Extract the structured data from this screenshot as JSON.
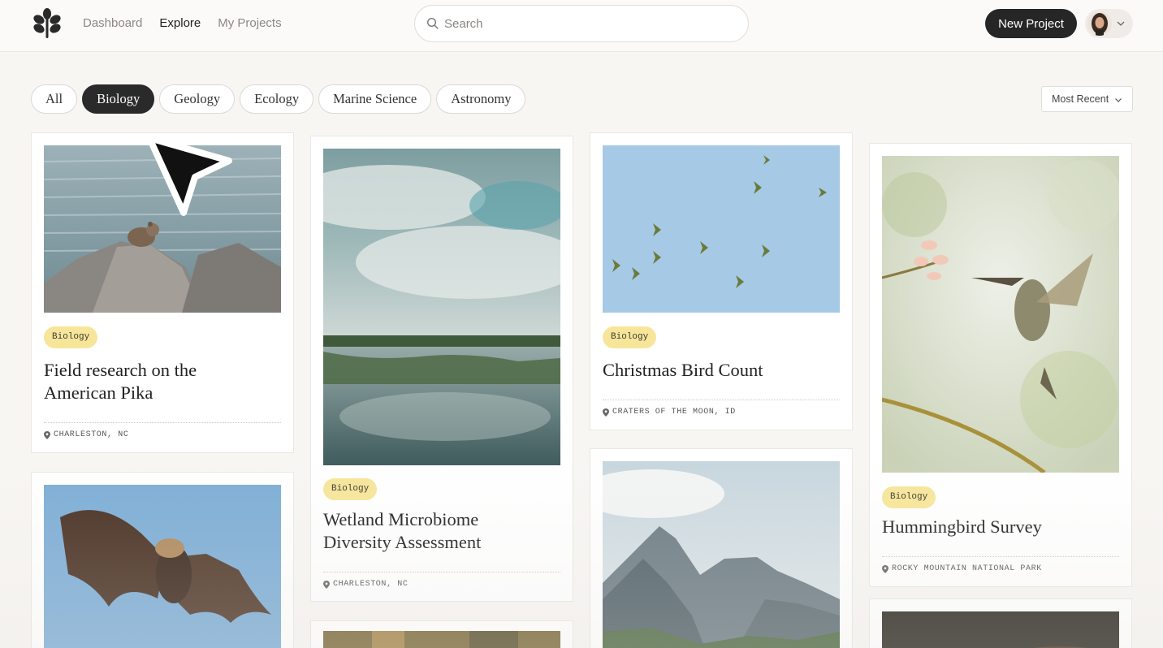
{
  "nav": {
    "items": [
      {
        "label": "Dashboard",
        "active": false
      },
      {
        "label": "Explore",
        "active": true
      },
      {
        "label": "My Projects",
        "active": false
      }
    ]
  },
  "search": {
    "placeholder": "Search",
    "value": ""
  },
  "header": {
    "new_project_label": "New Project"
  },
  "filters": {
    "items": [
      {
        "label": "All",
        "active": false
      },
      {
        "label": "Biology",
        "active": true
      },
      {
        "label": "Geology",
        "active": false
      },
      {
        "label": "Ecology",
        "active": false
      },
      {
        "label": "Marine Science",
        "active": false
      },
      {
        "label": "Astronomy",
        "active": false
      }
    ],
    "sort_label": "Most Recent"
  },
  "cards": [
    {
      "tag": "Biology",
      "title": "Field research on the American Pika",
      "location": "CHARLESTON, NC"
    },
    {
      "tag": "Biology",
      "title": "Wetland Microbiome Diversity Assessment",
      "location": "CHARLESTON, NC"
    },
    {
      "tag": "Biology",
      "title": "Christmas Bird Count",
      "location": "CRATERS OF THE MOON, ID"
    },
    {
      "tag": "Biology",
      "title": "Hummingbird Survey",
      "location": "ROCKY MOUNTAIN NATIONAL PARK"
    }
  ],
  "colors": {
    "accent_dark": "#262626",
    "tag_bg": "#f7e69a",
    "background": "#f8f6f3"
  }
}
